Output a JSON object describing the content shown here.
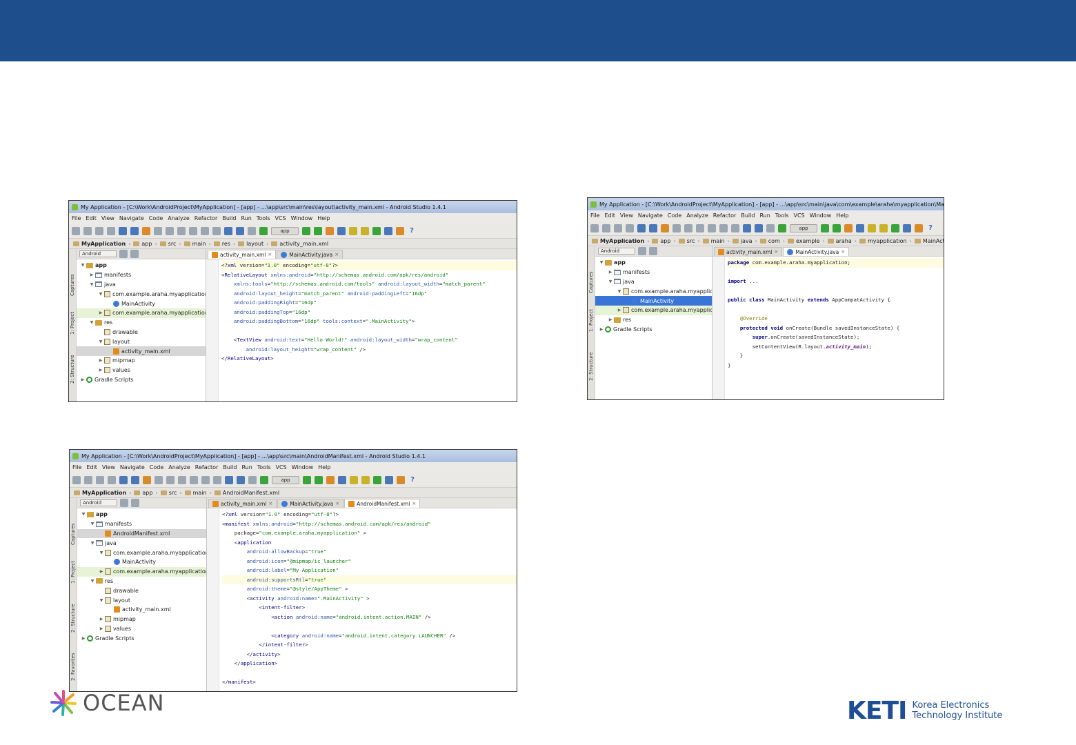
{
  "menu": [
    "File",
    "Edit",
    "View",
    "Navigate",
    "Code",
    "Analyze",
    "Refactor",
    "Build",
    "Run",
    "Tools",
    "VCS",
    "Window",
    "Help"
  ],
  "toolbar": {
    "run_config": "app",
    "help": "?"
  },
  "sidebar": {
    "captures": "Captures",
    "project": "1: Project",
    "structure": "2: Structure",
    "favorites": "2: Favorites"
  },
  "project_view": "Android",
  "window1": {
    "title": "My Application - [C:\\Work\\AndroidProject\\MyApplication] - [app] - ...\\app\\src\\main\\res\\layout\\activity_main.xml - Android Studio 1.4.1",
    "breadcrumb": [
      "MyApplication",
      "app",
      "src",
      "main",
      "res",
      "layout",
      "activity_main.xml"
    ],
    "tabs": [
      "activity_main.xml",
      "MainActivity.java"
    ],
    "tree": [
      {
        "label": "app",
        "depth": 0,
        "arrow": "▼",
        "icon": "foldres",
        "bold": true
      },
      {
        "label": "manifests",
        "depth": 1,
        "arrow": "▶",
        "icon": "fold"
      },
      {
        "label": "java",
        "depth": 1,
        "arrow": "▼",
        "icon": "fold"
      },
      {
        "label": "com.example.araha.myapplication",
        "depth": 2,
        "arrow": "▼",
        "icon": "pkg"
      },
      {
        "label": "MainActivity",
        "depth": 3,
        "arrow": "",
        "icon": "cls"
      },
      {
        "label": "com.example.araha.myapplication",
        "depth": 2,
        "arrow": "▶",
        "icon": "pkg",
        "hl": true
      },
      {
        "label": "res",
        "depth": 1,
        "arrow": "▼",
        "icon": "foldres"
      },
      {
        "label": "drawable",
        "depth": 2,
        "arrow": "",
        "icon": "pkg"
      },
      {
        "label": "layout",
        "depth": 2,
        "arrow": "▼",
        "icon": "pkg"
      },
      {
        "label": "activity_main.xml",
        "depth": 3,
        "arrow": "",
        "icon": "xml",
        "sel": true
      },
      {
        "label": "mipmap",
        "depth": 2,
        "arrow": "▶",
        "icon": "pkg"
      },
      {
        "label": "values",
        "depth": 2,
        "arrow": "▶",
        "icon": "pkg"
      },
      {
        "label": "Gradle Scripts",
        "depth": 0,
        "arrow": "▶",
        "icon": "gradle"
      }
    ],
    "code": [
      "<?xml version=\"1.0\" encoding=\"utf-8\"?>",
      "<RelativeLayout xmlns:android=\"http://schemas.android.com/apk/res/android\"",
      "    xmlns:tools=\"http://schemas.android.com/tools\" android:layout_width=\"match_parent\"",
      "    android:layout_height=\"match_parent\" android:paddingLeft=\"16dp\"",
      "    android:paddingRight=\"16dp\"",
      "    android:paddingTop=\"16dp\"",
      "    android:paddingBottom=\"16dp\" tools:context=\".MainActivity\">",
      "",
      "    <TextView android:text=\"Hello World!\" android:layout_width=\"wrap_content\"",
      "        android:layout_height=\"wrap_content\" />",
      "</RelativeLayout>"
    ]
  },
  "window2": {
    "title": "My Application - [C:\\Work\\AndroidProject\\MyApplication] - [app] - ...\\app\\src\\main\\java\\com\\example\\araha\\myapplication\\MainA",
    "breadcrumb": [
      "MyApplication",
      "app",
      "src",
      "main",
      "java",
      "com",
      "example",
      "araha",
      "myapplication",
      "MainActivity"
    ],
    "tabs": [
      "activity_main.xml",
      "MainActivity.java"
    ],
    "tree": [
      {
        "label": "app",
        "depth": 0,
        "arrow": "▼",
        "icon": "foldres",
        "bold": true
      },
      {
        "label": "manifests",
        "depth": 1,
        "arrow": "▶",
        "icon": "fold"
      },
      {
        "label": "java",
        "depth": 1,
        "arrow": "▼",
        "icon": "fold"
      },
      {
        "label": "com.example.araha.myapplication",
        "depth": 2,
        "arrow": "▼",
        "icon": "pkg"
      },
      {
        "label": "MainActivity",
        "depth": 3,
        "arrow": "",
        "icon": "cls",
        "blue": true
      },
      {
        "label": "com.example.araha.myapplication",
        "depth": 2,
        "arrow": "▶",
        "icon": "pkg",
        "hl": true
      },
      {
        "label": "res",
        "depth": 1,
        "arrow": "▶",
        "icon": "foldres"
      },
      {
        "label": "Gradle Scripts",
        "depth": 0,
        "arrow": "▶",
        "icon": "gradle"
      }
    ],
    "code": [
      "package com.example.araha.myapplication;",
      "",
      "import ...",
      "",
      "public class MainActivity extends AppCompatActivity {",
      "",
      "    @Override",
      "    protected void onCreate(Bundle savedInstanceState) {",
      "        super.onCreate(savedInstanceState);",
      "        setContentView(R.layout.activity_main);",
      "    }",
      "}"
    ]
  },
  "window3": {
    "title": "My Application - [C:\\Work\\AndroidProject\\MyApplication] - [app] - ...\\app\\src\\main\\AndroidManifest.xml - Android Studio 1.4.1",
    "breadcrumb": [
      "MyApplication",
      "app",
      "src",
      "main",
      "AndroidManifest.xml"
    ],
    "tabs": [
      "activity_main.xml",
      "MainActivity.java",
      "AndroidManifest.xml"
    ],
    "tree": [
      {
        "label": "app",
        "depth": 0,
        "arrow": "▼",
        "icon": "foldres",
        "bold": true
      },
      {
        "label": "manifests",
        "depth": 1,
        "arrow": "▼",
        "icon": "fold"
      },
      {
        "label": "AndroidManifest.xml",
        "depth": 2,
        "arrow": "",
        "icon": "xml",
        "sel": true
      },
      {
        "label": "java",
        "depth": 1,
        "arrow": "▼",
        "icon": "fold"
      },
      {
        "label": "com.example.araha.myapplication",
        "depth": 2,
        "arrow": "▼",
        "icon": "pkg"
      },
      {
        "label": "MainActivity",
        "depth": 3,
        "arrow": "",
        "icon": "cls"
      },
      {
        "label": "com.example.araha.myapplication",
        "depth": 2,
        "arrow": "▶",
        "icon": "pkg",
        "hl": true
      },
      {
        "label": "res",
        "depth": 1,
        "arrow": "▼",
        "icon": "foldres"
      },
      {
        "label": "drawable",
        "depth": 2,
        "arrow": "",
        "icon": "pkg"
      },
      {
        "label": "layout",
        "depth": 2,
        "arrow": "▼",
        "icon": "pkg"
      },
      {
        "label": "activity_main.xml",
        "depth": 3,
        "arrow": "",
        "icon": "xml"
      },
      {
        "label": "mipmap",
        "depth": 2,
        "arrow": "▶",
        "icon": "pkg"
      },
      {
        "label": "values",
        "depth": 2,
        "arrow": "▶",
        "icon": "pkg"
      },
      {
        "label": "Gradle Scripts",
        "depth": 0,
        "arrow": "▶",
        "icon": "gradle"
      }
    ],
    "code": [
      "<?xml version=\"1.0\" encoding=\"utf-8\"?>",
      "<manifest xmlns:android=\"http://schemas.android.com/apk/res/android\"",
      "    package=\"com.example.araha.myapplication\" >",
      "    <application",
      "        android:allowBackup=\"true\"",
      "        android:icon=\"@mipmap/ic_launcher\"",
      "        android:label=\"My Application\"",
      "        android:supportsRtl=\"true\"",
      "        android:theme=\"@style/AppTheme\" >",
      "        <activity android:name=\".MainActivity\" >",
      "            <intent-filter>",
      "                <action android:name=\"android.intent.action.MAIN\" />",
      "",
      "                <category android:name=\"android.intent.category.LAUNCHER\" />",
      "            </intent-filter>",
      "        </activity>",
      "    </application>",
      "",
      "</manifest>"
    ]
  },
  "logos": {
    "left": "OCEAN",
    "right_mark": "KETI",
    "right_line1": "Korea Electronics",
    "right_line2": "Technology Institute"
  },
  "colors": {
    "banner": "#1f4e8c",
    "keti_blue": "#1e4f96"
  }
}
